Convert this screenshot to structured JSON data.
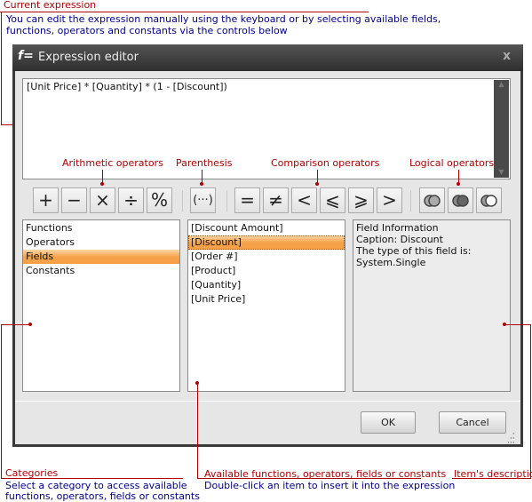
{
  "annotations": {
    "current_expression": {
      "title": "Current expression",
      "desc1": "You can edit the expression manually using the keyboard or by selecting available fields,",
      "desc2": "functions, operators and constants via the controls below"
    },
    "arithmetic": "Arithmetic operators",
    "parenthesis": "Parenthesis",
    "comparison": "Comparison operators",
    "logical": "Logical operators",
    "categories": {
      "title": "Categories",
      "desc1": "Select a category to access available",
      "desc2": "functions, operators, fields or constants"
    },
    "available": {
      "title": "Available functions, operators, fields or constants",
      "desc1": "Double-click an item to insert it into the expression"
    },
    "description": {
      "title": "Item's description"
    }
  },
  "window": {
    "title": "Expression editor",
    "close": "x"
  },
  "expression": "[Unit Price] * [Quantity] * (1 - [Discount])",
  "operators": {
    "plus": "+",
    "minus": "−",
    "multiply": "×",
    "divide": "÷",
    "modulo": "%",
    "parenthesis": "(···)",
    "equal": "=",
    "not_equal": "≠",
    "less": "<",
    "less_equal": "⩽",
    "greater_equal": "⩾",
    "greater": ">"
  },
  "categories": [
    {
      "label": "Functions"
    },
    {
      "label": "Operators"
    },
    {
      "label": "Fields",
      "selected": true
    },
    {
      "label": "Constants"
    }
  ],
  "items": [
    {
      "label": "[Discount Amount]"
    },
    {
      "label": "[Discount]",
      "selected": true
    },
    {
      "label": "[Order #]"
    },
    {
      "label": "[Product]"
    },
    {
      "label": "[Quantity]"
    },
    {
      "label": "[Unit Price]"
    }
  ],
  "info": {
    "line1": "Field Information",
    "line2": "Caption: Discount",
    "line3": "The type of this field is:",
    "line4": "System.Single"
  },
  "buttons": {
    "ok": "OK",
    "cancel": "Cancel"
  },
  "colors": {
    "annotation_red": "#b00000",
    "annotation_blue": "#00008b",
    "selection_orange": "#f7a24a"
  }
}
